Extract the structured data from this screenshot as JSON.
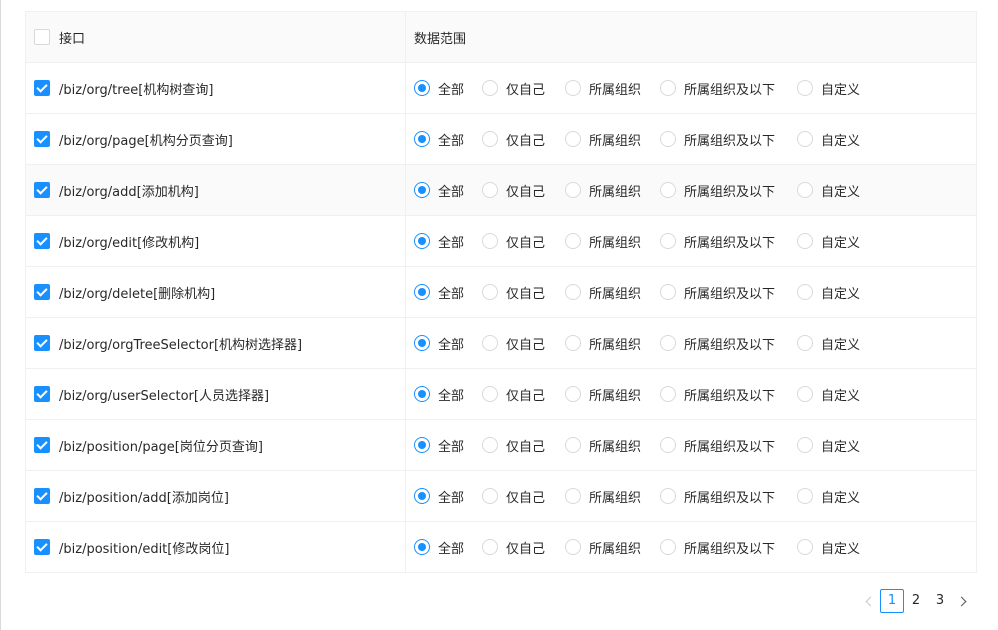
{
  "header": {
    "api_label": "接口",
    "scope_label": "数据范围"
  },
  "options": [
    "全部",
    "仅自己",
    "所属组织",
    "所属组织及以下",
    "自定义"
  ],
  "rows": [
    {
      "api": "/biz/org/tree[机构树查询]"
    },
    {
      "api": "/biz/org/page[机构分页查询]"
    },
    {
      "api": "/biz/org/add[添加机构]"
    },
    {
      "api": "/biz/org/edit[修改机构]"
    },
    {
      "api": "/biz/org/delete[删除机构]"
    },
    {
      "api": "/biz/org/orgTreeSelector[机构树选择器]"
    },
    {
      "api": "/biz/org/userSelector[人员选择器]"
    },
    {
      "api": "/biz/position/page[岗位分页查询]"
    },
    {
      "api": "/biz/position/add[添加岗位]"
    },
    {
      "api": "/biz/position/edit[修改岗位]"
    }
  ],
  "selected_option_index": 0,
  "pagination": {
    "pages": [
      "1",
      "2",
      "3"
    ],
    "current": "1"
  },
  "colors": {
    "primary": "#1890ff",
    "border": "#f0f0f0",
    "row_alt": "#fafafa"
  }
}
